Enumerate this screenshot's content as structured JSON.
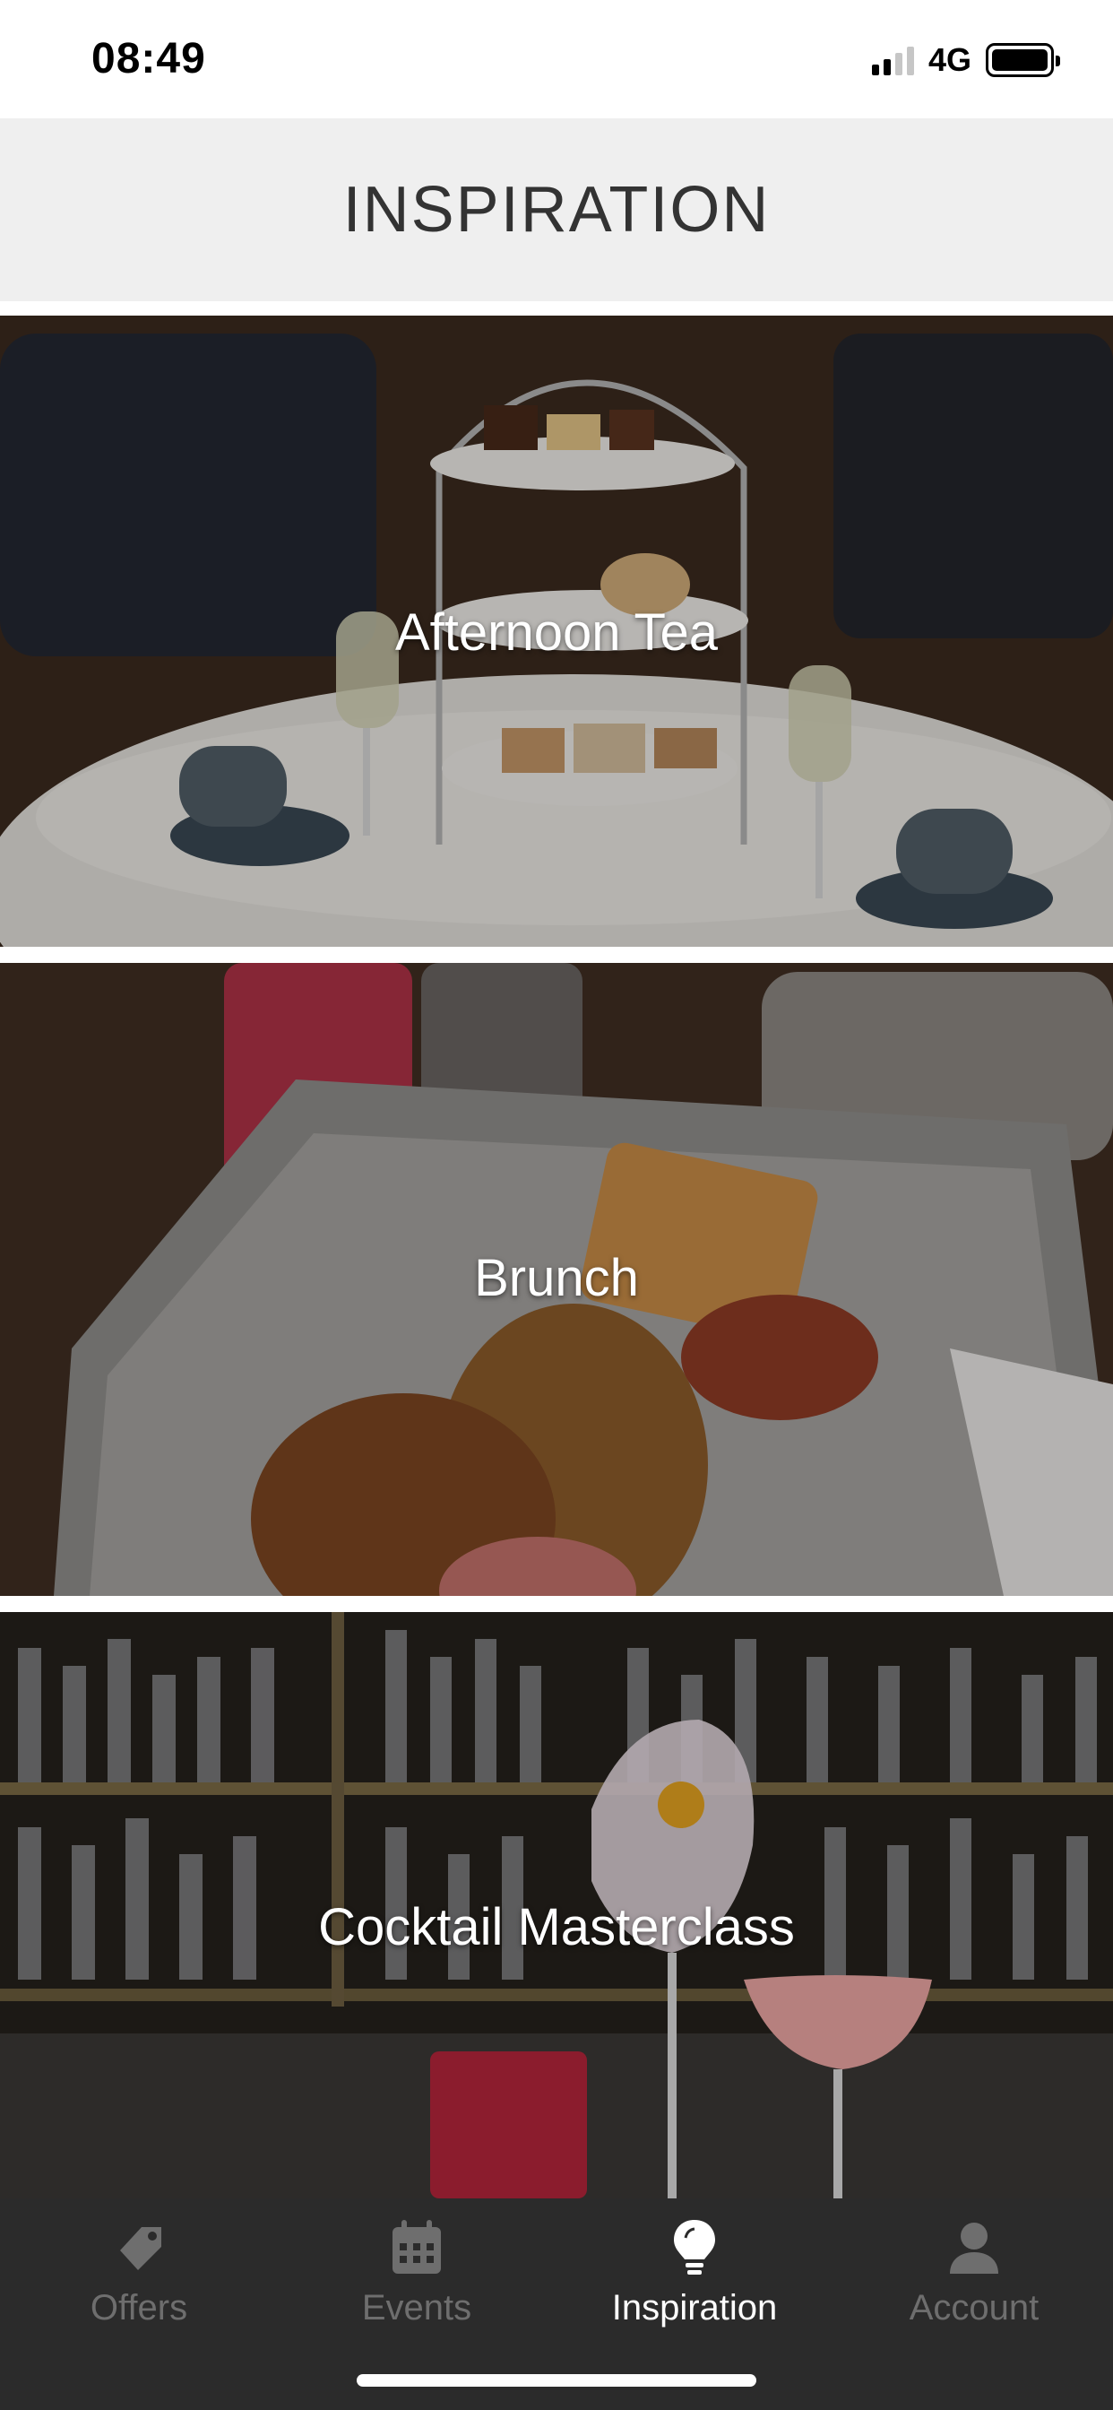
{
  "status_bar": {
    "time": "08:49",
    "network": "4G"
  },
  "header": {
    "title": "INSPIRATION"
  },
  "cards": [
    {
      "title": "Afternoon Tea"
    },
    {
      "title": "Brunch"
    },
    {
      "title": "Cocktail Masterclass"
    }
  ],
  "tab_bar": {
    "tabs": [
      {
        "label": "Offers",
        "icon": "tag-icon",
        "active": false
      },
      {
        "label": "Events",
        "icon": "calendar-icon",
        "active": false
      },
      {
        "label": "Inspiration",
        "icon": "lightbulb-icon",
        "active": true
      },
      {
        "label": "Account",
        "icon": "user-icon",
        "active": false
      }
    ]
  },
  "colors": {
    "header_bg": "#efefef",
    "tab_bar_bg": "#2b2b2b",
    "active_tab": "#ffffff",
    "inactive_tab": "#6e6e6e"
  }
}
